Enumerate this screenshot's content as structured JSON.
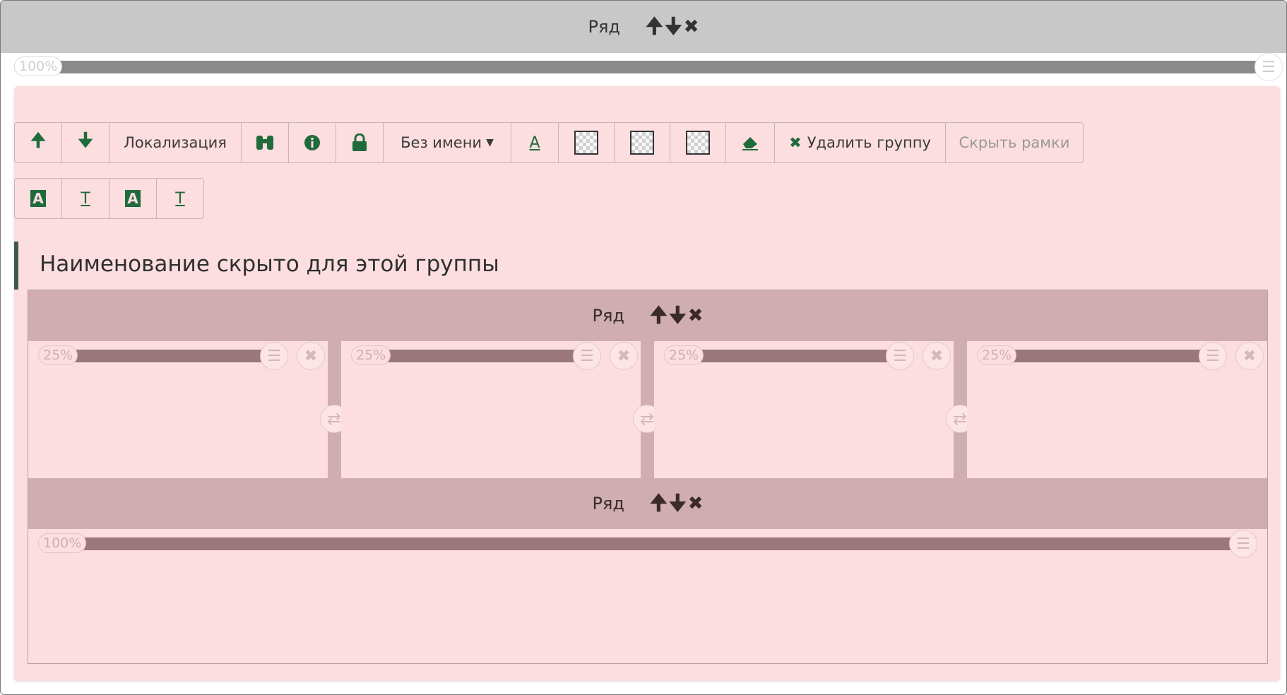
{
  "outer_row": {
    "label": "Ряд",
    "up": "🠉",
    "down": "🠋",
    "close": "✖",
    "width_label": "100%",
    "settings_icon": "settings-list-icon"
  },
  "toolbar": {
    "up_icon": "🠉",
    "down_icon": "🠋",
    "localization_label": "Локализация",
    "binoculars_icon": "binoculars-icon",
    "info_icon": "info-icon",
    "lock_icon": "lock-icon",
    "name_dropdown_label": "Без имени",
    "text_color_icon": "A",
    "eraser_icon": "eraser-icon",
    "delete_group_label": "Удалить группу",
    "hide_frames_label": "Скрыть рамки"
  },
  "toolbar2": {
    "icons": [
      "A",
      "T",
      "A",
      "T"
    ]
  },
  "group": {
    "title": "Наименование скрыто для этой группы"
  },
  "inner_rows": [
    {
      "label": "Ряд",
      "up": "🠉",
      "down": "🠋",
      "close": "✖",
      "columns": [
        {
          "width_label": "25%"
        },
        {
          "width_label": "25%"
        },
        {
          "width_label": "25%"
        },
        {
          "width_label": "25%"
        }
      ]
    },
    {
      "label": "Ряд",
      "up": "🠉",
      "down": "🠋",
      "close": "✖",
      "columns": [
        {
          "width_label": "100%"
        }
      ]
    }
  ],
  "colors": {
    "outer_header": "#c8c8c8",
    "group_bg": "#fcdde0",
    "inner_header": "#cfadb0",
    "accent_green": "#1f6b3a"
  }
}
